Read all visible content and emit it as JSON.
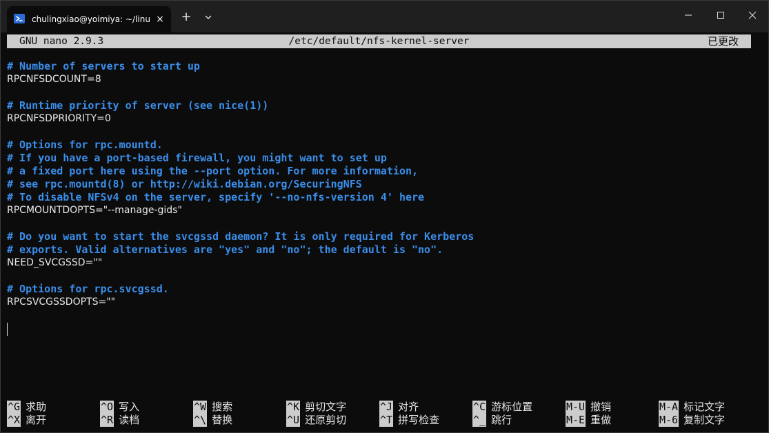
{
  "window": {
    "tab_title": "chulingxiao@yoimiya: ~/linux",
    "tab_close_icon": "×",
    "new_tab_icon": "+"
  },
  "nano": {
    "version": "GNU nano 2.9.3",
    "filename": "/etc/default/nfs-kernel-server",
    "status": "已更改"
  },
  "editor": {
    "lines": [
      {
        "text": "# Number of servers to start up",
        "kind": "comment"
      },
      {
        "text": "RPCNFSDCOUNT=8",
        "kind": "code"
      },
      {
        "text": "",
        "kind": "blank"
      },
      {
        "text": "# Runtime priority of server (see nice(1))",
        "kind": "comment"
      },
      {
        "text": "RPCNFSDPRIORITY=0",
        "kind": "code"
      },
      {
        "text": "",
        "kind": "blank"
      },
      {
        "text": "# Options for rpc.mountd.",
        "kind": "comment"
      },
      {
        "text": "# If you have a port-based firewall, you might want to set up",
        "kind": "comment"
      },
      {
        "text": "# a fixed port here using the --port option. For more information,",
        "kind": "comment"
      },
      {
        "text": "# see rpc.mountd(8) or http://wiki.debian.org/SecuringNFS",
        "kind": "comment"
      },
      {
        "text": "# To disable NFSv4 on the server, specify '--no-nfs-version 4' here",
        "kind": "comment"
      },
      {
        "text": "RPCMOUNTDOPTS=\"--manage-gids\"",
        "kind": "code"
      },
      {
        "text": "",
        "kind": "blank"
      },
      {
        "text": "# Do you want to start the svcgssd daemon? It is only required for Kerberos",
        "kind": "comment"
      },
      {
        "text": "# exports. Valid alternatives are \"yes\" and \"no\"; the default is \"no\".",
        "kind": "comment"
      },
      {
        "text": "NEED_SVCGSSD=\"\"",
        "kind": "code"
      },
      {
        "text": "",
        "kind": "blank"
      },
      {
        "text": "# Options for rpc.svcgssd.",
        "kind": "comment"
      },
      {
        "text": "RPCSVCGSSDOPTS=\"\"",
        "kind": "code"
      }
    ]
  },
  "shortcuts": [
    {
      "key": "^G",
      "label": "求助"
    },
    {
      "key": "^X",
      "label": "离开"
    },
    {
      "key": "^O",
      "label": "写入"
    },
    {
      "key": "^R",
      "label": "读档"
    },
    {
      "key": "^W",
      "label": "搜索"
    },
    {
      "key": "^\\",
      "label": "替换"
    },
    {
      "key": "^K",
      "label": "剪切文字"
    },
    {
      "key": "^U",
      "label": "还原剪切"
    },
    {
      "key": "^J",
      "label": "对齐"
    },
    {
      "key": "^T",
      "label": "拼写检查"
    },
    {
      "key": "^C",
      "label": "游标位置"
    },
    {
      "key": "^_",
      "label": "跳行"
    },
    {
      "key": "M-U",
      "label": "撤销"
    },
    {
      "key": "M-E",
      "label": "重做"
    },
    {
      "key": "M-A",
      "label": "标记文字"
    },
    {
      "key": "M-6",
      "label": "复制文字"
    }
  ],
  "colors": {
    "background": "#0c0c0c",
    "comment": "#3b8eea",
    "text": "#e6e6e6",
    "highlight_bg": "#cccccc"
  },
  "icons": {
    "tab": "powershell-icon",
    "dropdown": "chevron-down-icon",
    "minimize": "minimize-icon",
    "maximize": "maximize-icon",
    "close": "close-icon"
  }
}
